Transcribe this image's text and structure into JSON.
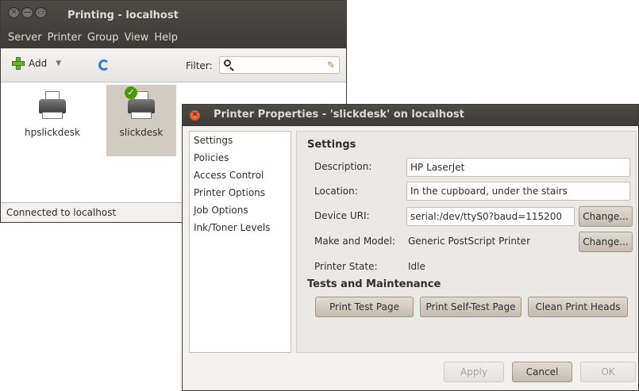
{
  "main_window": {
    "title": "Printing - localhost",
    "window_buttons": [
      "✕",
      "—",
      "▭"
    ],
    "menu": [
      "Server",
      "Printer",
      "Group",
      "View",
      "Help"
    ],
    "toolbar": {
      "add_label": "Add",
      "add_dropdown_glyph": "▼",
      "filter_label": "Filter:",
      "filter_value": "",
      "icons": [
        "plus-icon",
        "refresh-icon",
        "search-icon",
        "clear-broom-icon"
      ]
    },
    "printers": [
      {
        "name": "hpslickdesk",
        "selected": false,
        "default": false
      },
      {
        "name": "slickdesk",
        "selected": true,
        "default": true
      }
    ],
    "status": "Connected to localhost"
  },
  "dialog": {
    "title": "Printer Properties - 'slickdesk' on localhost",
    "close_glyph": "✕",
    "nav_items": [
      "Settings",
      "Policies",
      "Access Control",
      "Printer Options",
      "Job Options",
      "Ink/Toner Levels"
    ],
    "settings": {
      "heading": "Settings",
      "description_label": "Description:",
      "description_value": "HP LaserJet",
      "location_label": "Location:",
      "location_value": "In the cupboard, under the stairs",
      "device_uri_label": "Device URI:",
      "device_uri_value": "serial:/dev/ttyS0?baud=115200",
      "make_model_label": "Make and Model:",
      "make_model_value": "Generic PostScript Printer",
      "state_label": "Printer State:",
      "state_value": "Idle",
      "change_label": "Change..."
    },
    "maintenance": {
      "heading": "Tests and Maintenance",
      "buttons": [
        "Print Test Page",
        "Print Self-Test Page",
        "Clean Print Heads"
      ]
    },
    "footer": {
      "apply_label": "Apply",
      "cancel_label": "Cancel",
      "ok_label": "OK"
    }
  },
  "colors": {
    "titlebar": "#3c3b37",
    "window_bg": "#f2f1f0",
    "selection": "#d1cbc1",
    "button": "#c5bcb0",
    "close_button": "#e55a28",
    "add_icon": "#6bb22a",
    "refresh_icon": "#3a7bd5"
  }
}
